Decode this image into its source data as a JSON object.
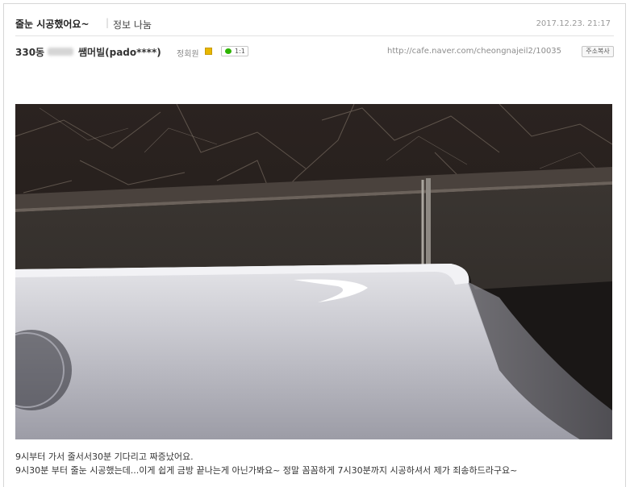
{
  "post": {
    "title": "줄눈 시공했어요~",
    "separator": "|",
    "board": "정보 나눔",
    "date": "2017.12.23. 21:17"
  },
  "author": {
    "dong": "330동",
    "name": "쌤머빌(pado****)",
    "level": "정회원",
    "level_icon": "level-badge-icon",
    "chat_label": "1:1",
    "url": "http://cafe.naver.com/cheongnajeil2/10035",
    "copy_label": "주소복사"
  },
  "photo": {
    "icon": "bathtub-photo"
  },
  "content": {
    "line1": "9시부터 가서 줄서서30분 기다리고 짜증났어요.",
    "line2": "9시30분 부터 줄눈 시공했는데...이게 쉽게 금방 끝나는게 아닌가봐요~ 정말 꼼꼼하게 7시30분까지 시공하셔서 제가 죄송하드라구요~"
  },
  "colors": {
    "accent_green": "#2db400",
    "level_yellow": "#e8b700",
    "marble_dark": "#2a2421",
    "tub_white": "#d8d8dc"
  }
}
